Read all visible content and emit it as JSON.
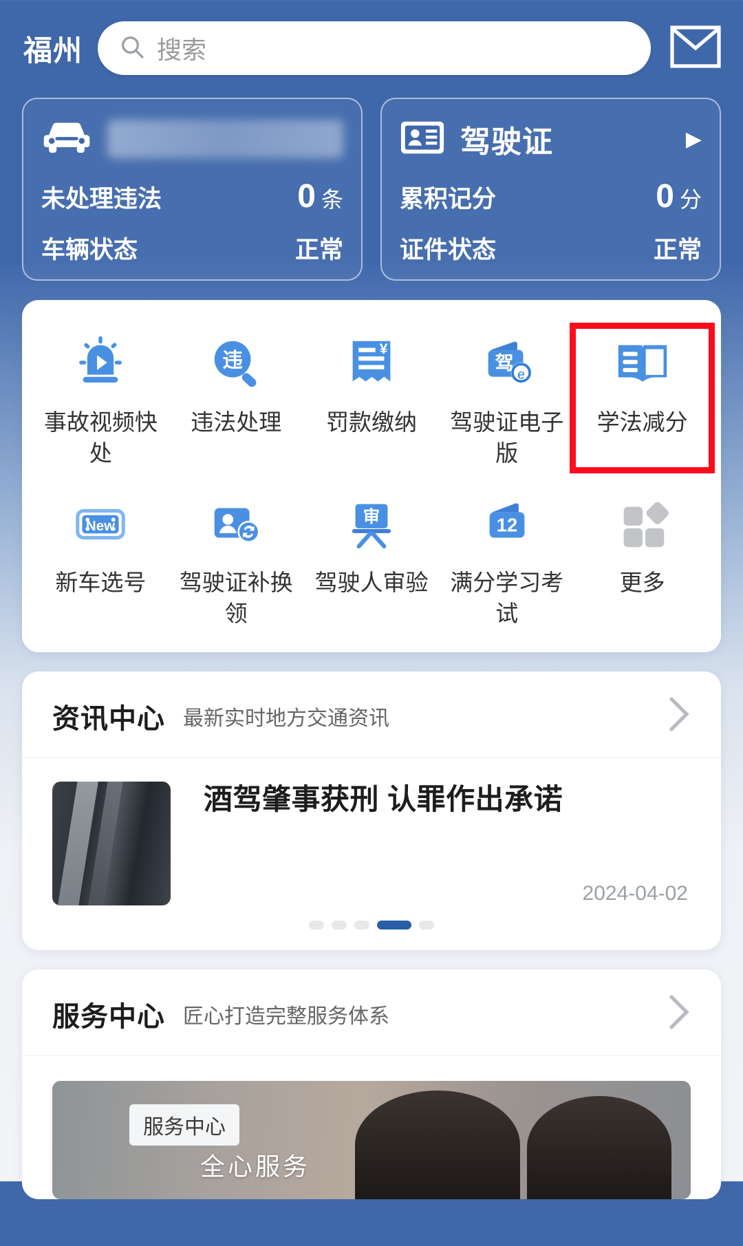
{
  "header": {
    "city": "福州",
    "search_placeholder": "搜索",
    "search_value": "",
    "search_icon": "search-icon",
    "mail_icon": "mail-envelope-icon"
  },
  "status_cards": [
    {
      "icon": "car-icon",
      "title": "",
      "title_redacted": true,
      "arrow": "",
      "rows": [
        {
          "label": "未处理违法",
          "value": "0",
          "unit": "条"
        },
        {
          "label": "车辆状态",
          "value": "正常",
          "unit": ""
        }
      ]
    },
    {
      "icon": "id-card-icon",
      "title": "驾驶证",
      "title_redacted": false,
      "arrow": "▶",
      "rows": [
        {
          "label": "累积记分",
          "value": "0",
          "unit": "分"
        },
        {
          "label": "证件状态",
          "value": "正常",
          "unit": ""
        }
      ]
    }
  ],
  "grid": {
    "rows": [
      [
        {
          "icon": "siren-play-icon",
          "label": "事故视频快处",
          "highlighted": false
        },
        {
          "icon": "violation-search-icon",
          "label": "违法处理",
          "highlighted": false
        },
        {
          "icon": "fine-receipt-icon",
          "label": "罚款缴纳",
          "highlighted": false
        },
        {
          "icon": "driver-license-e-wallet-icon",
          "label": "驾驶证电子版",
          "highlighted": false
        },
        {
          "icon": "open-book-icon",
          "label": "学法减分",
          "highlighted": true
        }
      ],
      [
        {
          "icon": "new-plate-icon",
          "label": "新车选号",
          "highlighted": false
        },
        {
          "icon": "license-renew-icon",
          "label": "驾驶证补换领",
          "highlighted": false
        },
        {
          "icon": "review-board-icon",
          "label": "驾驶人审验",
          "highlighted": false
        },
        {
          "icon": "twelve-points-icon",
          "label": "满分学习考试",
          "highlighted": false
        },
        {
          "icon": "more-grid-icon",
          "label": "更多",
          "highlighted": false
        }
      ]
    ],
    "highlight_color": "#fc0d1c"
  },
  "news_center": {
    "title": "资讯中心",
    "subtitle": "最新实时地方交通资讯",
    "chevron": "chevron-right-icon",
    "article": {
      "thumbnail": "highway-aerial-photo",
      "title": "酒驾肇事获刑 认罪作出承诺",
      "date": "2024-04-02"
    },
    "pagination": {
      "total": 5,
      "active_index": 3
    }
  },
  "service_center": {
    "title": "服务中心",
    "subtitle": "匠心打造完整服务体系",
    "chevron": "chevron-right-icon",
    "banner": {
      "tag": "服务中心",
      "caption": "全心服务",
      "image": "call-center-operators-photo"
    }
  },
  "colors": {
    "brand_blue": "#3f68ab",
    "accent_blue": "#4a90e2",
    "highlight_red": "#fc0d1c",
    "active_dot": "#2a5da8"
  }
}
